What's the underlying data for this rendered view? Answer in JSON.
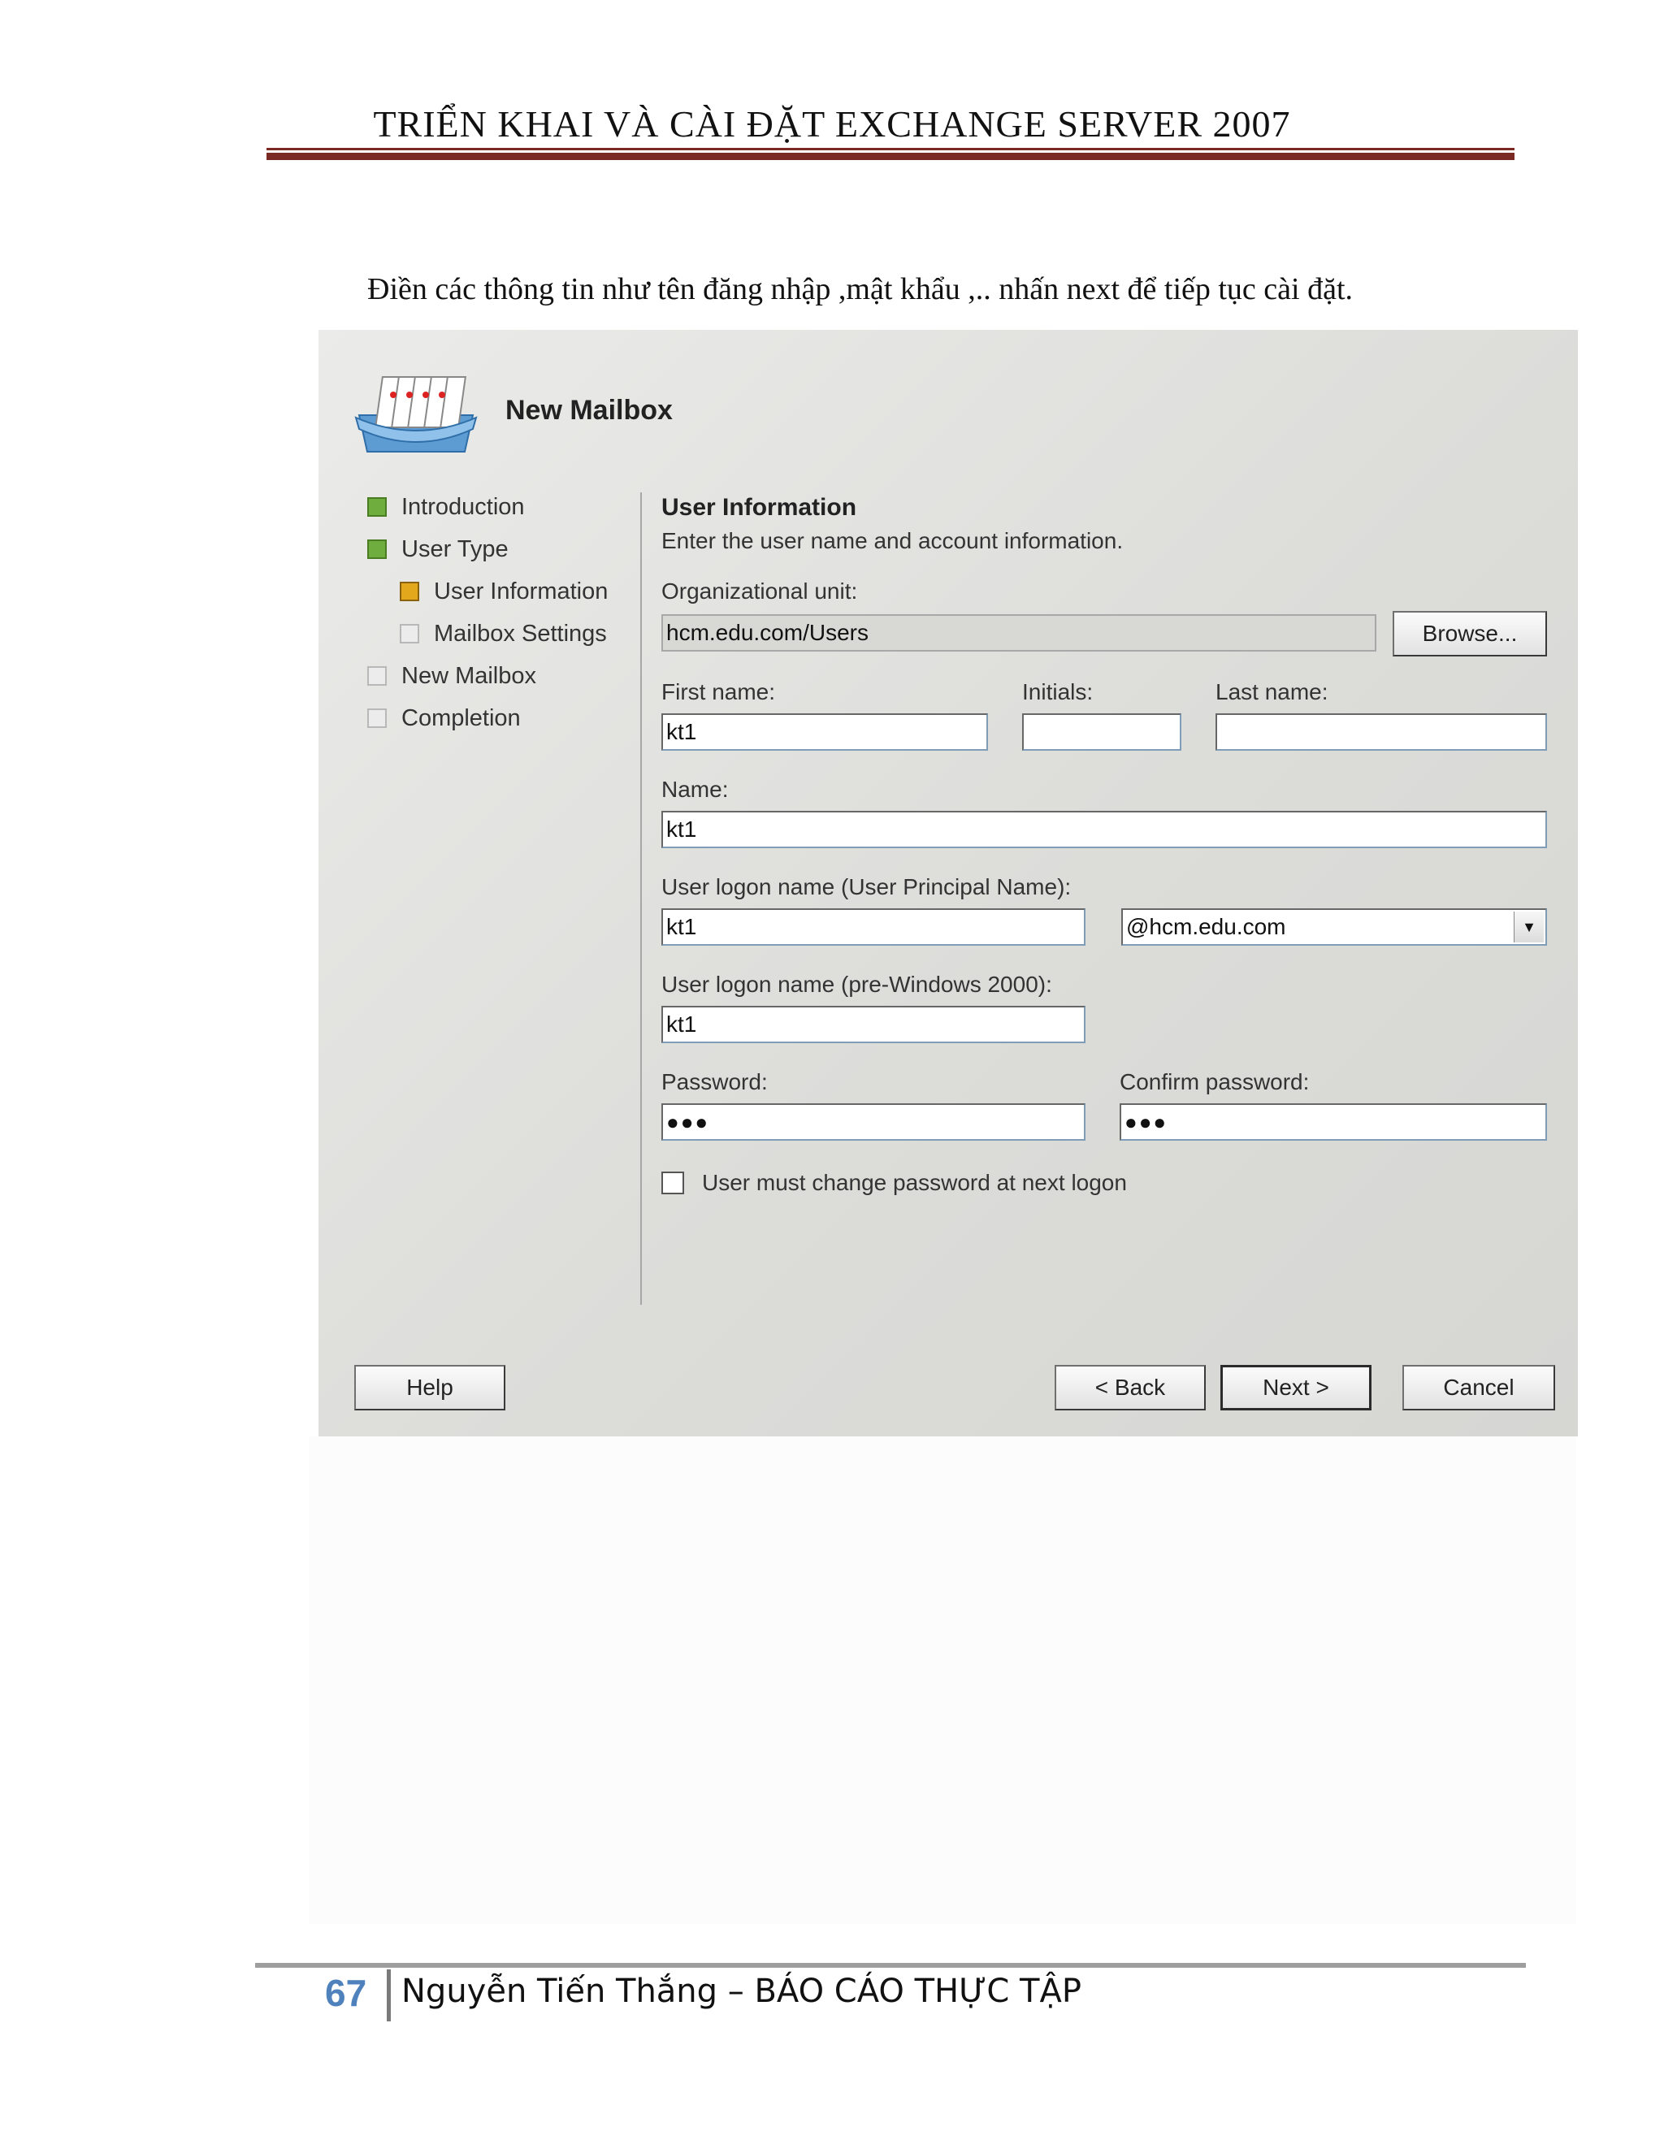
{
  "document": {
    "header_title": "TRIỂN KHAI VÀ CÀI ĐẶT EXCHANGE SERVER 2007",
    "intro_text": "Điền các thông tin như tên đăng nhập ,mật khẩu ,.. nhấn next để tiếp tục cài đặt.",
    "footer": {
      "page_number": "67",
      "text": "Nguyễn Tiến Thắng – BÁO CÁO THỰC TẬP"
    }
  },
  "wizard": {
    "title": "New Mailbox",
    "icon": "mailbox-icon",
    "steps": [
      {
        "label": "Introduction",
        "state": "done"
      },
      {
        "label": "User Type",
        "state": "done"
      },
      {
        "label": "User Information",
        "state": "current"
      },
      {
        "label": "Mailbox Settings",
        "state": "pending"
      },
      {
        "label": "New Mailbox",
        "state": "pending"
      },
      {
        "label": "Completion",
        "state": "pending"
      }
    ],
    "step_colors": {
      "done": "#6fae3e",
      "current": "#e3a81c",
      "pending": "#ececec"
    },
    "section_title": "User Information",
    "section_desc": "Enter the user name and account information.",
    "org_unit_label": "Organizational unit:",
    "org_unit_value": "hcm.edu.com/Users",
    "browse_label": "Browse...",
    "first_name_label": "First name:",
    "first_name_value": "kt1",
    "initials_label": "Initials:",
    "initials_value": "",
    "last_name_label": "Last name:",
    "last_name_value": "",
    "name_label": "Name:",
    "name_value": "kt1",
    "upn_label": "User logon name (User Principal Name):",
    "upn_value": "kt1",
    "upn_domain": "@hcm.edu.com",
    "prewin_label": "User logon name (pre-Windows 2000):",
    "prewin_value": "kt1",
    "password_label": "Password:",
    "password_value": "●●●",
    "confirm_label": "Confirm password:",
    "confirm_value": "●●●",
    "must_change_label": "User must change password at next logon",
    "must_change_checked": false,
    "buttons": {
      "help": "Help",
      "back": "< Back",
      "next": "Next >",
      "cancel": "Cancel"
    }
  }
}
